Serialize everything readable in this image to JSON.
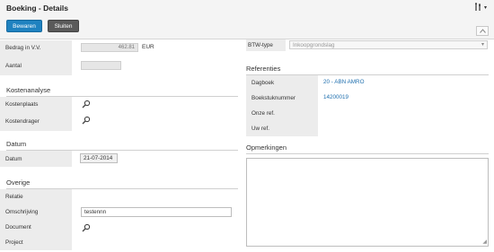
{
  "header": {
    "title": "Boeking - Details",
    "tools_icon": "tools-icon",
    "save_label": "Bewaren",
    "close_label": "Sluiten",
    "collapse_icon": "chevron-up-icon"
  },
  "left": {
    "amount": {
      "label": "Bedrag in V.V.",
      "value": "462.81",
      "unit": "EUR"
    },
    "aantal": {
      "label": "Aantal"
    },
    "kostenanalyse": {
      "title": "Kostenanalyse",
      "kostenplaats": "Kostenplaats",
      "kostendrager": "Kostendrager"
    },
    "datum": {
      "title": "Datum",
      "label": "Datum",
      "value": "21-07-2014"
    },
    "overige": {
      "title": "Overige",
      "relatie": "Relatie",
      "omschrijving": "Omschrijving",
      "omschrijving_value": "testennn",
      "document": "Document",
      "project": "Project"
    }
  },
  "right": {
    "btw": {
      "label": "BTW-type",
      "value": "Inkoopgrondslag"
    },
    "referenties": {
      "title": "Referenties",
      "dagboek_label": "Dagboek",
      "dagboek_value": "20 - ABN AMRO",
      "boekstuk_label": "Boekstuknummer",
      "boekstuk_value": "14200019",
      "onze_ref": "Onze ref.",
      "uw_ref": "Uw ref."
    },
    "opmerkingen": {
      "title": "Opmerkingen",
      "value": ""
    }
  },
  "colors": {
    "accent": "#1f82c0",
    "link": "#1f6fae",
    "label_bg": "#ececec"
  }
}
